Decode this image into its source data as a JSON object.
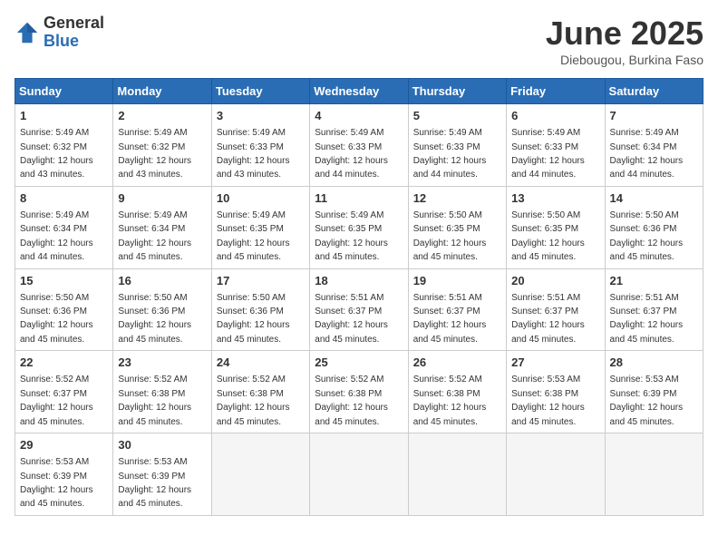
{
  "logo": {
    "general": "General",
    "blue": "Blue"
  },
  "header": {
    "title": "June 2025",
    "subtitle": "Diebougou, Burkina Faso"
  },
  "weekdays": [
    "Sunday",
    "Monday",
    "Tuesday",
    "Wednesday",
    "Thursday",
    "Friday",
    "Saturday"
  ],
  "days": [
    {
      "date": 1,
      "sunrise": "5:49 AM",
      "sunset": "6:32 PM",
      "daylight": "12 hours and 43 minutes."
    },
    {
      "date": 2,
      "sunrise": "5:49 AM",
      "sunset": "6:32 PM",
      "daylight": "12 hours and 43 minutes."
    },
    {
      "date": 3,
      "sunrise": "5:49 AM",
      "sunset": "6:33 PM",
      "daylight": "12 hours and 43 minutes."
    },
    {
      "date": 4,
      "sunrise": "5:49 AM",
      "sunset": "6:33 PM",
      "daylight": "12 hours and 44 minutes."
    },
    {
      "date": 5,
      "sunrise": "5:49 AM",
      "sunset": "6:33 PM",
      "daylight": "12 hours and 44 minutes."
    },
    {
      "date": 6,
      "sunrise": "5:49 AM",
      "sunset": "6:33 PM",
      "daylight": "12 hours and 44 minutes."
    },
    {
      "date": 7,
      "sunrise": "5:49 AM",
      "sunset": "6:34 PM",
      "daylight": "12 hours and 44 minutes."
    },
    {
      "date": 8,
      "sunrise": "5:49 AM",
      "sunset": "6:34 PM",
      "daylight": "12 hours and 44 minutes."
    },
    {
      "date": 9,
      "sunrise": "5:49 AM",
      "sunset": "6:34 PM",
      "daylight": "12 hours and 45 minutes."
    },
    {
      "date": 10,
      "sunrise": "5:49 AM",
      "sunset": "6:35 PM",
      "daylight": "12 hours and 45 minutes."
    },
    {
      "date": 11,
      "sunrise": "5:49 AM",
      "sunset": "6:35 PM",
      "daylight": "12 hours and 45 minutes."
    },
    {
      "date": 12,
      "sunrise": "5:50 AM",
      "sunset": "6:35 PM",
      "daylight": "12 hours and 45 minutes."
    },
    {
      "date": 13,
      "sunrise": "5:50 AM",
      "sunset": "6:35 PM",
      "daylight": "12 hours and 45 minutes."
    },
    {
      "date": 14,
      "sunrise": "5:50 AM",
      "sunset": "6:36 PM",
      "daylight": "12 hours and 45 minutes."
    },
    {
      "date": 15,
      "sunrise": "5:50 AM",
      "sunset": "6:36 PM",
      "daylight": "12 hours and 45 minutes."
    },
    {
      "date": 16,
      "sunrise": "5:50 AM",
      "sunset": "6:36 PM",
      "daylight": "12 hours and 45 minutes."
    },
    {
      "date": 17,
      "sunrise": "5:50 AM",
      "sunset": "6:36 PM",
      "daylight": "12 hours and 45 minutes."
    },
    {
      "date": 18,
      "sunrise": "5:51 AM",
      "sunset": "6:37 PM",
      "daylight": "12 hours and 45 minutes."
    },
    {
      "date": 19,
      "sunrise": "5:51 AM",
      "sunset": "6:37 PM",
      "daylight": "12 hours and 45 minutes."
    },
    {
      "date": 20,
      "sunrise": "5:51 AM",
      "sunset": "6:37 PM",
      "daylight": "12 hours and 45 minutes."
    },
    {
      "date": 21,
      "sunrise": "5:51 AM",
      "sunset": "6:37 PM",
      "daylight": "12 hours and 45 minutes."
    },
    {
      "date": 22,
      "sunrise": "5:52 AM",
      "sunset": "6:37 PM",
      "daylight": "12 hours and 45 minutes."
    },
    {
      "date": 23,
      "sunrise": "5:52 AM",
      "sunset": "6:38 PM",
      "daylight": "12 hours and 45 minutes."
    },
    {
      "date": 24,
      "sunrise": "5:52 AM",
      "sunset": "6:38 PM",
      "daylight": "12 hours and 45 minutes."
    },
    {
      "date": 25,
      "sunrise": "5:52 AM",
      "sunset": "6:38 PM",
      "daylight": "12 hours and 45 minutes."
    },
    {
      "date": 26,
      "sunrise": "5:52 AM",
      "sunset": "6:38 PM",
      "daylight": "12 hours and 45 minutes."
    },
    {
      "date": 27,
      "sunrise": "5:53 AM",
      "sunset": "6:38 PM",
      "daylight": "12 hours and 45 minutes."
    },
    {
      "date": 28,
      "sunrise": "5:53 AM",
      "sunset": "6:39 PM",
      "daylight": "12 hours and 45 minutes."
    },
    {
      "date": 29,
      "sunrise": "5:53 AM",
      "sunset": "6:39 PM",
      "daylight": "12 hours and 45 minutes."
    },
    {
      "date": 30,
      "sunrise": "5:53 AM",
      "sunset": "6:39 PM",
      "daylight": "12 hours and 45 minutes."
    }
  ],
  "labels": {
    "sunrise": "Sunrise:",
    "sunset": "Sunset:",
    "daylight": "Daylight:"
  }
}
